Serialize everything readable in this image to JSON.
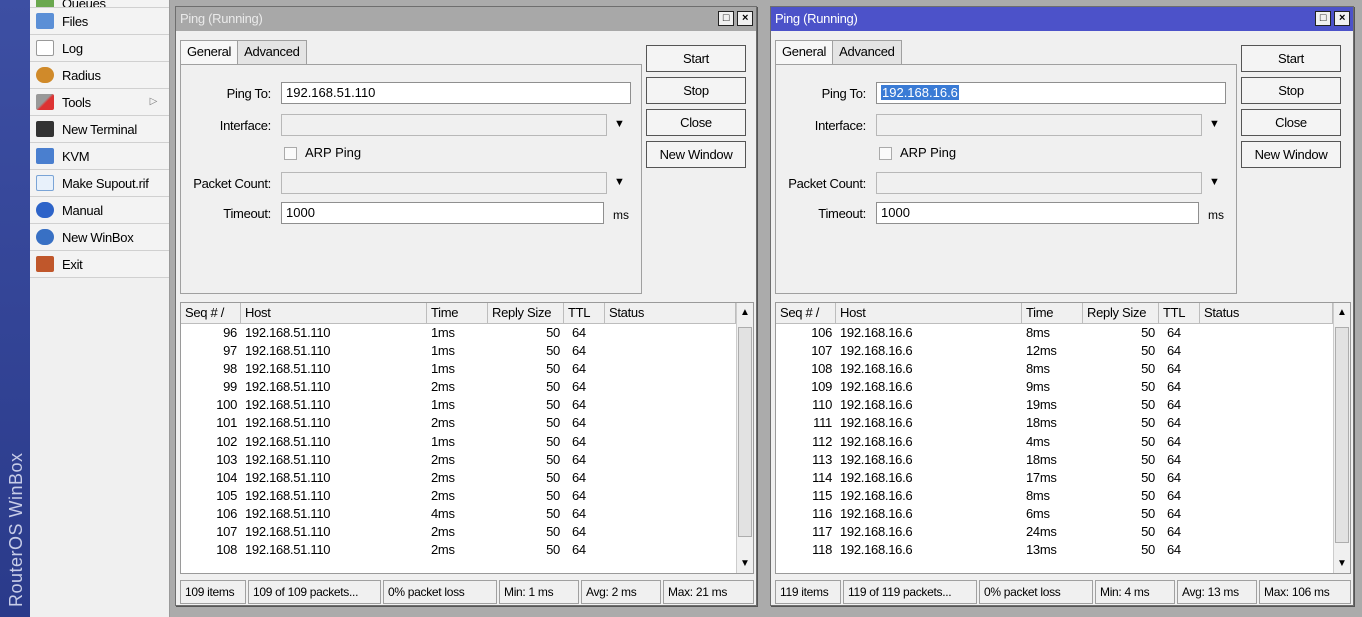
{
  "brand": "RouterOS WinBox",
  "menu": {
    "items": [
      {
        "label": "Queues",
        "icon": "queues-icon",
        "color": "#6aa84f"
      },
      {
        "label": "Files",
        "icon": "files-icon",
        "color": "#5b8fd6"
      },
      {
        "label": "Log",
        "icon": "log-icon",
        "color": "#cccccc"
      },
      {
        "label": "Radius",
        "icon": "radius-icon",
        "color": "#d08a2a"
      },
      {
        "label": "Tools",
        "icon": "tools-icon",
        "color": "#888888"
      },
      {
        "label": "New Terminal",
        "icon": "terminal-icon",
        "color": "#333333"
      },
      {
        "label": "KVM",
        "icon": "kvm-icon",
        "color": "#4a7fcf"
      },
      {
        "label": "Make Supout.rif",
        "icon": "supout-icon",
        "color": "#9ec3e6"
      },
      {
        "label": "Manual",
        "icon": "manual-icon",
        "color": "#2d63c8"
      },
      {
        "label": "New WinBox",
        "icon": "winbox-icon",
        "color": "#3870c4"
      },
      {
        "label": "Exit",
        "icon": "exit-icon",
        "color": "#c0572b"
      }
    ]
  },
  "windows": [
    {
      "title": "Ping (Running)",
      "tabs": [
        "General",
        "Advanced"
      ],
      "ping_to_label": "Ping To:",
      "ping_to_value": "192.168.51.110",
      "interface_label": "Interface:",
      "arp_label": "ARP Ping",
      "packet_count_label": "Packet Count:",
      "timeout_label": "Timeout:",
      "timeout_value": "1000",
      "timeout_units": "ms",
      "buttons": [
        "Start",
        "Stop",
        "Close",
        "New Window"
      ],
      "columns": [
        "Seq # /",
        "Host",
        "Time",
        "Reply Size",
        "TTL",
        "Status"
      ],
      "rows": [
        [
          "96",
          "192.168.51.110",
          "1ms",
          "50",
          "64"
        ],
        [
          "97",
          "192.168.51.110",
          "1ms",
          "50",
          "64"
        ],
        [
          "98",
          "192.168.51.110",
          "1ms",
          "50",
          "64"
        ],
        [
          "99",
          "192.168.51.110",
          "2ms",
          "50",
          "64"
        ],
        [
          "100",
          "192.168.51.110",
          "1ms",
          "50",
          "64"
        ],
        [
          "101",
          "192.168.51.110",
          "2ms",
          "50",
          "64"
        ],
        [
          "102",
          "192.168.51.110",
          "1ms",
          "50",
          "64"
        ],
        [
          "103",
          "192.168.51.110",
          "2ms",
          "50",
          "64"
        ],
        [
          "104",
          "192.168.51.110",
          "2ms",
          "50",
          "64"
        ],
        [
          "105",
          "192.168.51.110",
          "2ms",
          "50",
          "64"
        ],
        [
          "106",
          "192.168.51.110",
          "4ms",
          "50",
          "64"
        ],
        [
          "107",
          "192.168.51.110",
          "2ms",
          "50",
          "64"
        ],
        [
          "108",
          "192.168.51.110",
          "2ms",
          "50",
          "64"
        ]
      ],
      "status": [
        "109 items",
        "109 of 109 packets...",
        "0% packet loss",
        "Min: 1 ms",
        "Avg: 2 ms",
        "Max: 21 ms"
      ]
    },
    {
      "title": "Ping (Running)",
      "tabs": [
        "General",
        "Advanced"
      ],
      "ping_to_label": "Ping To:",
      "ping_to_value": "192.168.16.6",
      "interface_label": "Interface:",
      "arp_label": "ARP Ping",
      "packet_count_label": "Packet Count:",
      "timeout_label": "Timeout:",
      "timeout_value": "1000",
      "timeout_units": "ms",
      "buttons": [
        "Start",
        "Stop",
        "Close",
        "New Window"
      ],
      "columns": [
        "Seq # /",
        "Host",
        "Time",
        "Reply Size",
        "TTL",
        "Status"
      ],
      "rows": [
        [
          "106",
          "192.168.16.6",
          "8ms",
          "50",
          "64"
        ],
        [
          "107",
          "192.168.16.6",
          "12ms",
          "50",
          "64"
        ],
        [
          "108",
          "192.168.16.6",
          "8ms",
          "50",
          "64"
        ],
        [
          "109",
          "192.168.16.6",
          "9ms",
          "50",
          "64"
        ],
        [
          "110",
          "192.168.16.6",
          "19ms",
          "50",
          "64"
        ],
        [
          "111",
          "192.168.16.6",
          "18ms",
          "50",
          "64"
        ],
        [
          "112",
          "192.168.16.6",
          "4ms",
          "50",
          "64"
        ],
        [
          "113",
          "192.168.16.6",
          "18ms",
          "50",
          "64"
        ],
        [
          "114",
          "192.168.16.6",
          "17ms",
          "50",
          "64"
        ],
        [
          "115",
          "192.168.16.6",
          "8ms",
          "50",
          "64"
        ],
        [
          "116",
          "192.168.16.6",
          "6ms",
          "50",
          "64"
        ],
        [
          "117",
          "192.168.16.6",
          "24ms",
          "50",
          "64"
        ],
        [
          "118",
          "192.168.16.6",
          "13ms",
          "50",
          "64"
        ]
      ],
      "status": [
        "119 items",
        "119 of 119 packets...",
        "0% packet loss",
        "Min: 4 ms",
        "Avg: 13 ms",
        "Max: 106 ms"
      ]
    }
  ]
}
